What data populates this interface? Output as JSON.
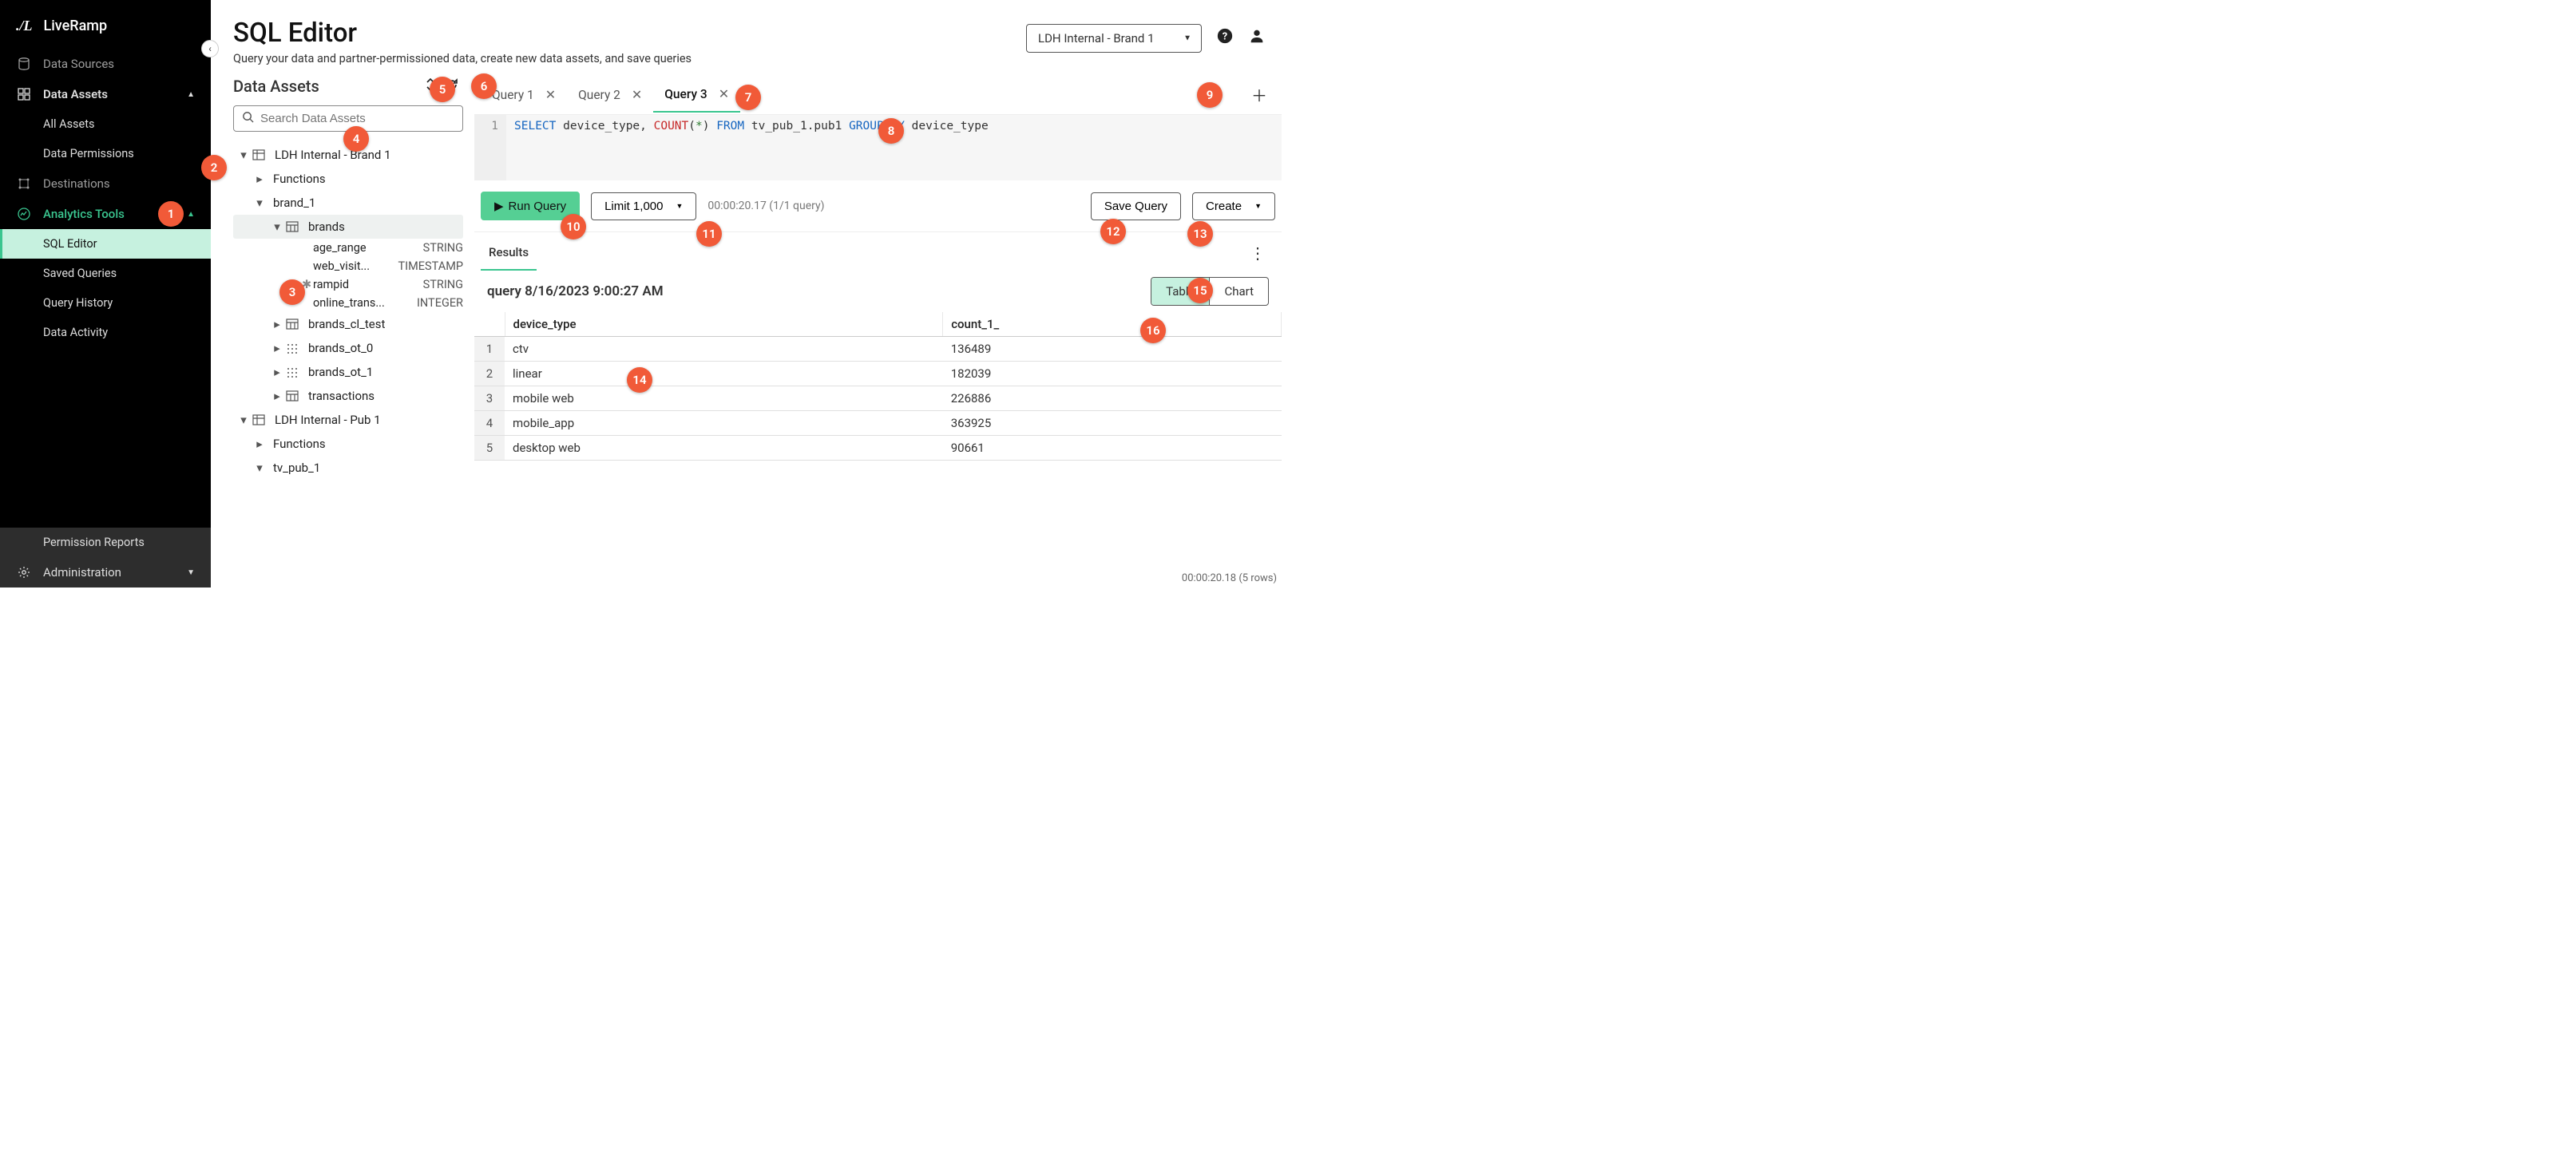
{
  "brandLogo": "./L",
  "brandName": "LiveRamp",
  "sidebar": {
    "dataSources": "Data Sources",
    "dataAssets": "Data Assets",
    "allAssets": "All Assets",
    "dataPermissions": "Data Permissions",
    "destinations": "Destinations",
    "analyticsTools": "Analytics Tools",
    "sqlEditor": "SQL Editor",
    "savedQueries": "Saved Queries",
    "queryHistory": "Query History",
    "dataActivity": "Data Activity",
    "permissionReports": "Permission Reports",
    "administration": "Administration"
  },
  "header": {
    "title": "SQL Editor",
    "subtitle": "Query your data and partner-permissioned data, create new data assets, and save queries",
    "brandSelect": "LDH Internal - Brand 1"
  },
  "assetsPanel": {
    "title": "Data Assets",
    "searchPlaceholder": "Search Data Assets",
    "tree": {
      "org1": "LDH Internal - Brand 1",
      "functions": "Functions",
      "brand1": "brand_1",
      "brands": "brands",
      "cols": [
        {
          "name": "age_range",
          "type": "STRING",
          "key": false
        },
        {
          "name": "web_visit...",
          "type": "TIMESTAMP",
          "key": false
        },
        {
          "name": "rampid",
          "type": "STRING",
          "key": true
        },
        {
          "name": "online_trans...",
          "type": "INTEGER",
          "key": false
        }
      ],
      "brands_cl_test": "brands_cl_test",
      "brands_ot_0": "brands_ot_0",
      "brands_ot_1": "brands_ot_1",
      "transactions": "transactions",
      "org2": "LDH Internal - Pub 1",
      "tv_pub_1": "tv_pub_1"
    }
  },
  "tabs": [
    {
      "label": "Query 1",
      "active": false
    },
    {
      "label": "Query 2",
      "active": false
    },
    {
      "label": "Query 3",
      "active": true
    }
  ],
  "code": {
    "line": "1",
    "segments": [
      {
        "t": "SELECT",
        "c": "kw-blue"
      },
      {
        "t": " device_type, ",
        "c": ""
      },
      {
        "t": "COUNT",
        "c": "kw-red"
      },
      {
        "t": "(",
        "c": ""
      },
      {
        "t": "*",
        "c": "kw-green"
      },
      {
        "t": ") ",
        "c": ""
      },
      {
        "t": "FROM",
        "c": "kw-blue"
      },
      {
        "t": " tv_pub_1.pub1 ",
        "c": ""
      },
      {
        "t": "GROUP",
        "c": "kw-blue"
      },
      {
        "t": " ",
        "c": ""
      },
      {
        "t": "BY",
        "c": "kw-blue"
      },
      {
        "t": " device_type",
        "c": ""
      }
    ]
  },
  "actions": {
    "run": "Run Query",
    "limit": "Limit 1,000",
    "status": "00:00:20.17 (1/1 query)",
    "save": "Save Query",
    "create": "Create"
  },
  "results": {
    "tab": "Results",
    "name": "query 8/16/2023 9:00:27 AM",
    "toggleTable": "Table",
    "toggleChart": "Chart",
    "columns": [
      "",
      "device_type",
      "count_1_"
    ],
    "rows": [
      [
        "1",
        "ctv",
        "136489"
      ],
      [
        "2",
        "linear",
        "182039"
      ],
      [
        "3",
        "mobile web",
        "226886"
      ],
      [
        "4",
        "mobile_app",
        "363925"
      ],
      [
        "5",
        "desktop web",
        "90661"
      ]
    ]
  },
  "statusBar": "00:00:20.18 (5 rows)",
  "callouts": {
    "1": "1",
    "2": "2",
    "3": "3",
    "4": "4",
    "5": "5",
    "6": "6",
    "7": "7",
    "8": "8",
    "9": "9",
    "10": "10",
    "11": "11",
    "12": "12",
    "13": "13",
    "14": "14",
    "15": "15",
    "16": "16"
  }
}
